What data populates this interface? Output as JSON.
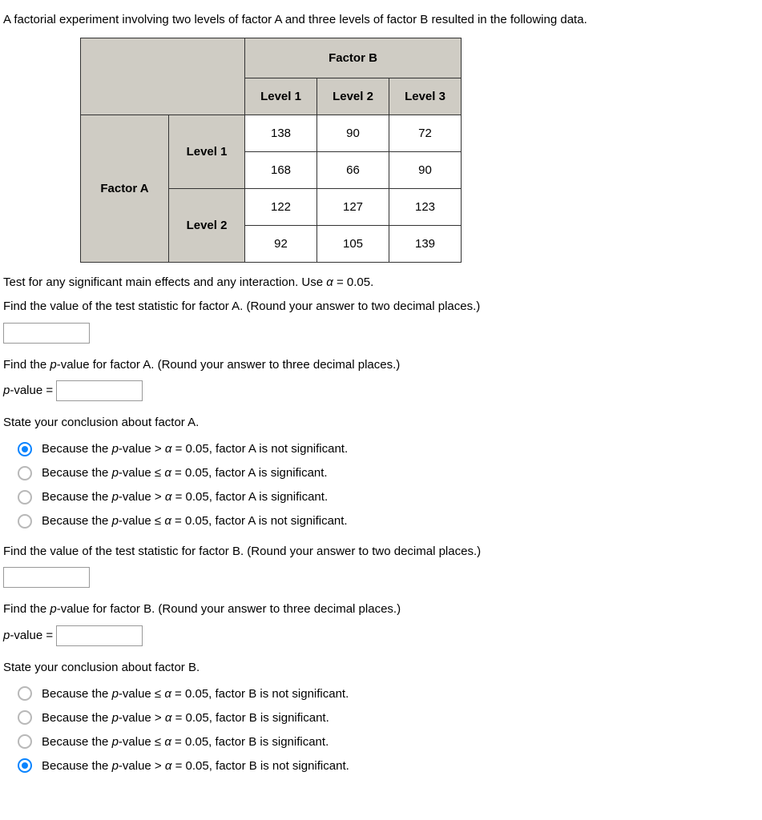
{
  "intro": "A factorial experiment involving two levels of factor A and three levels of factor B resulted in the following data.",
  "table": {
    "factorB_header": "Factor B",
    "colheaders": [
      "Level 1",
      "Level 2",
      "Level 3"
    ],
    "factorA_header": "Factor A",
    "rowheaders": [
      "Level 1",
      "Level 2"
    ],
    "data": [
      [
        "138",
        "90",
        "72"
      ],
      [
        "168",
        "66",
        "90"
      ],
      [
        "122",
        "127",
        "123"
      ],
      [
        "92",
        "105",
        "139"
      ]
    ]
  },
  "instruction": "Test for any significant main effects and any interaction. Use α = 0.05.",
  "factorA": {
    "test_stat_prompt": "Find the value of the test statistic for factor A. (Round your answer to two decimal places.)",
    "test_stat_value": "",
    "pvalue_prompt": "Find the p-value for factor A. (Round your answer to three decimal places.)",
    "pvalue_label": "p-value = ",
    "pvalue_value": "",
    "conclusion_prompt": "State your conclusion about factor A.",
    "options": [
      "Because the p-value > α = 0.05, factor A is not significant.",
      "Because the p-value ≤ α = 0.05, factor A is significant.",
      "Because the p-value > α = 0.05, factor A is significant.",
      "Because the p-value ≤ α = 0.05, factor A is not significant."
    ],
    "selected": 0
  },
  "factorB": {
    "test_stat_prompt": "Find the value of the test statistic for factor B. (Round your answer to two decimal places.)",
    "test_stat_value": "",
    "pvalue_prompt": "Find the p-value for factor B. (Round your answer to three decimal places.)",
    "pvalue_label": "p-value = ",
    "pvalue_value": "",
    "conclusion_prompt": "State your conclusion about factor B.",
    "options": [
      "Because the p-value ≤ α = 0.05, factor B is not significant.",
      "Because the p-value > α = 0.05, factor B is significant.",
      "Because the p-value ≤ α = 0.05, factor B is significant.",
      "Because the p-value > α = 0.05, factor B is not significant."
    ],
    "selected": 3
  }
}
